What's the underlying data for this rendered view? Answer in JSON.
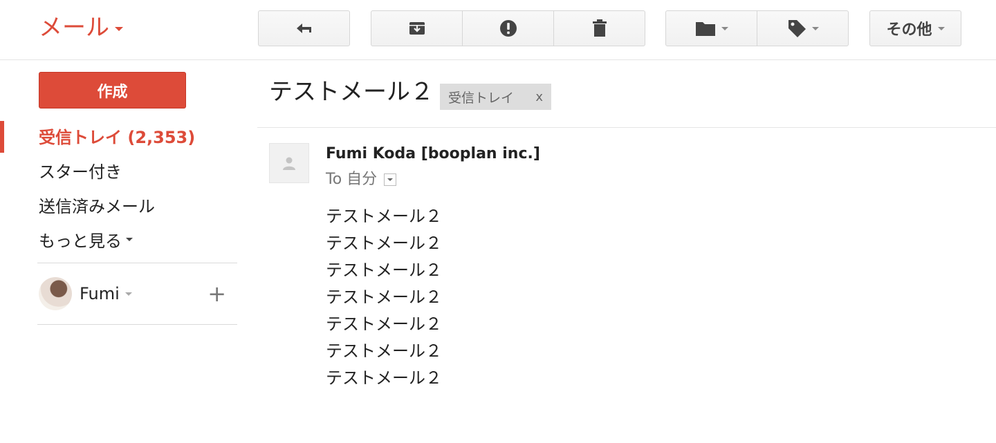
{
  "app_switcher": {
    "label": "メール"
  },
  "toolbar": {
    "more_label": "その他"
  },
  "sidebar": {
    "compose_label": "作成",
    "nav": [
      {
        "label": "受信トレイ (2,353)",
        "active": true
      },
      {
        "label": "スター付き"
      },
      {
        "label": "送信済みメール"
      },
      {
        "label": "もっと見る"
      }
    ],
    "profile": {
      "name": "Fumi",
      "add_icon": "+"
    }
  },
  "message": {
    "subject": "テストメール２",
    "label_chip": "受信トレイ",
    "label_remove": "x",
    "sender": "Fumi Koda [booplan inc.]",
    "to": "To 自分",
    "body_lines": [
      "テストメール２",
      "テストメール２",
      "テストメール２",
      "テストメール２",
      "テストメール２",
      "テストメール２",
      "テストメール２"
    ]
  },
  "icons": [
    "reply-icon",
    "archive-icon",
    "report-spam-icon",
    "delete-icon",
    "move-to-folder-icon",
    "label-icon",
    "plus-icon"
  ],
  "colors": {
    "brand_red": "#dd4b39",
    "toolbar_bg": "#f5f5f5",
    "label_chip_bg": "#dddddd"
  }
}
